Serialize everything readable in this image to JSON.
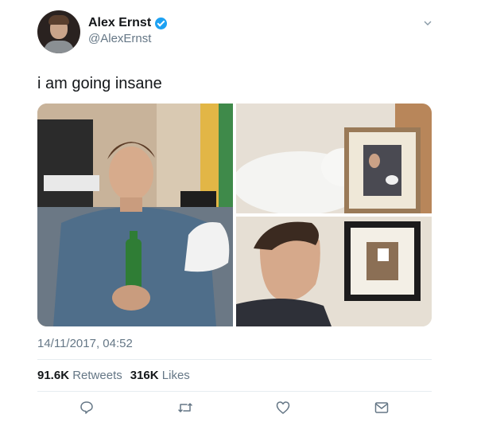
{
  "author": {
    "name": "Alex Ernst",
    "handle": "@AlexErnst",
    "verified": true
  },
  "tweet": {
    "text": "i am going insane",
    "timestamp": "14/11/2017, 04:52"
  },
  "media": [
    {
      "kind": "photo"
    },
    {
      "kind": "photo"
    },
    {
      "kind": "photo"
    }
  ],
  "stats": {
    "retweets_count": "91.6K",
    "retweets_label": "Retweets",
    "likes_count": "316K",
    "likes_label": "Likes"
  },
  "icons": {
    "reply": "reply-icon",
    "retweet": "retweet-icon",
    "like": "heart-icon",
    "dm": "envelope-icon",
    "menu": "chevron-down-icon"
  },
  "colors": {
    "text": "#14171a",
    "secondary": "#657786",
    "verified": "#1da1f2",
    "divider": "#e6ecf0"
  }
}
